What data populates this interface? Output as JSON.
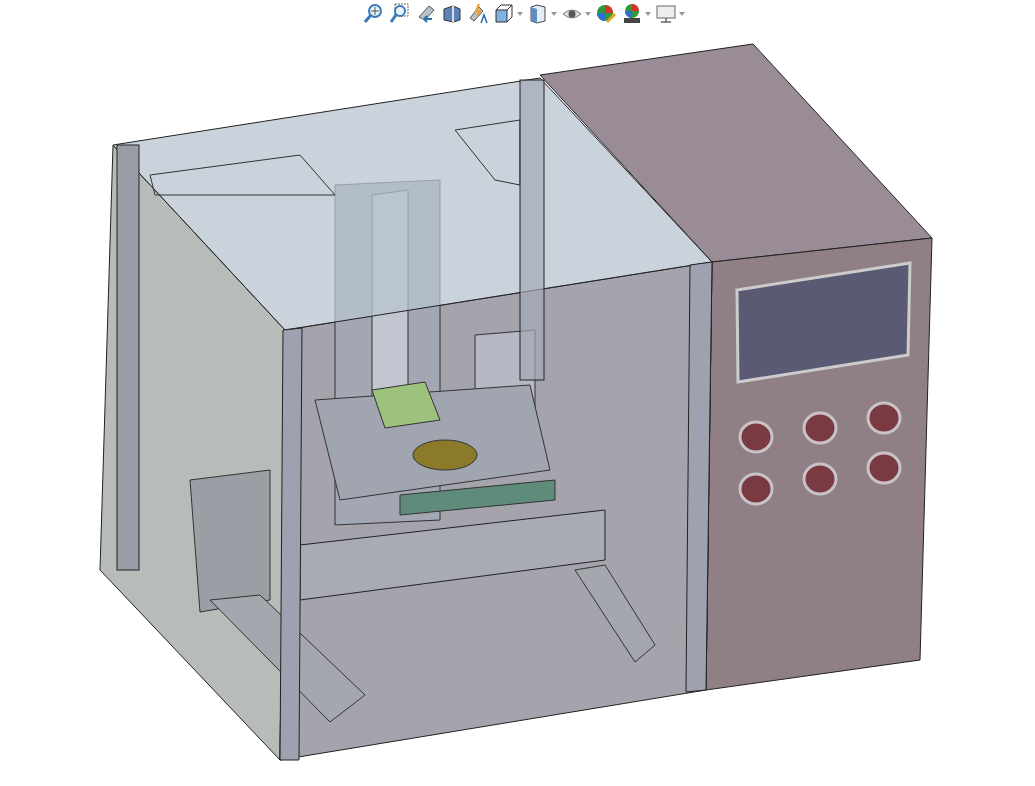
{
  "viewport": {
    "toolbar": [
      {
        "kind": "zoom-fit",
        "dropdown": false
      },
      {
        "kind": "zoom-area",
        "dropdown": false
      },
      {
        "kind": "previous-view",
        "dropdown": false
      },
      {
        "kind": "section",
        "dropdown": false
      },
      {
        "kind": "annotation",
        "dropdown": false
      },
      {
        "kind": "orientation",
        "dropdown": true
      },
      {
        "kind": "display-style",
        "dropdown": true
      },
      {
        "kind": "hide-show",
        "dropdown": true
      },
      {
        "kind": "appearance",
        "dropdown": false
      },
      {
        "kind": "scene",
        "dropdown": true
      },
      {
        "kind": "view-settings",
        "dropdown": true
      }
    ]
  }
}
